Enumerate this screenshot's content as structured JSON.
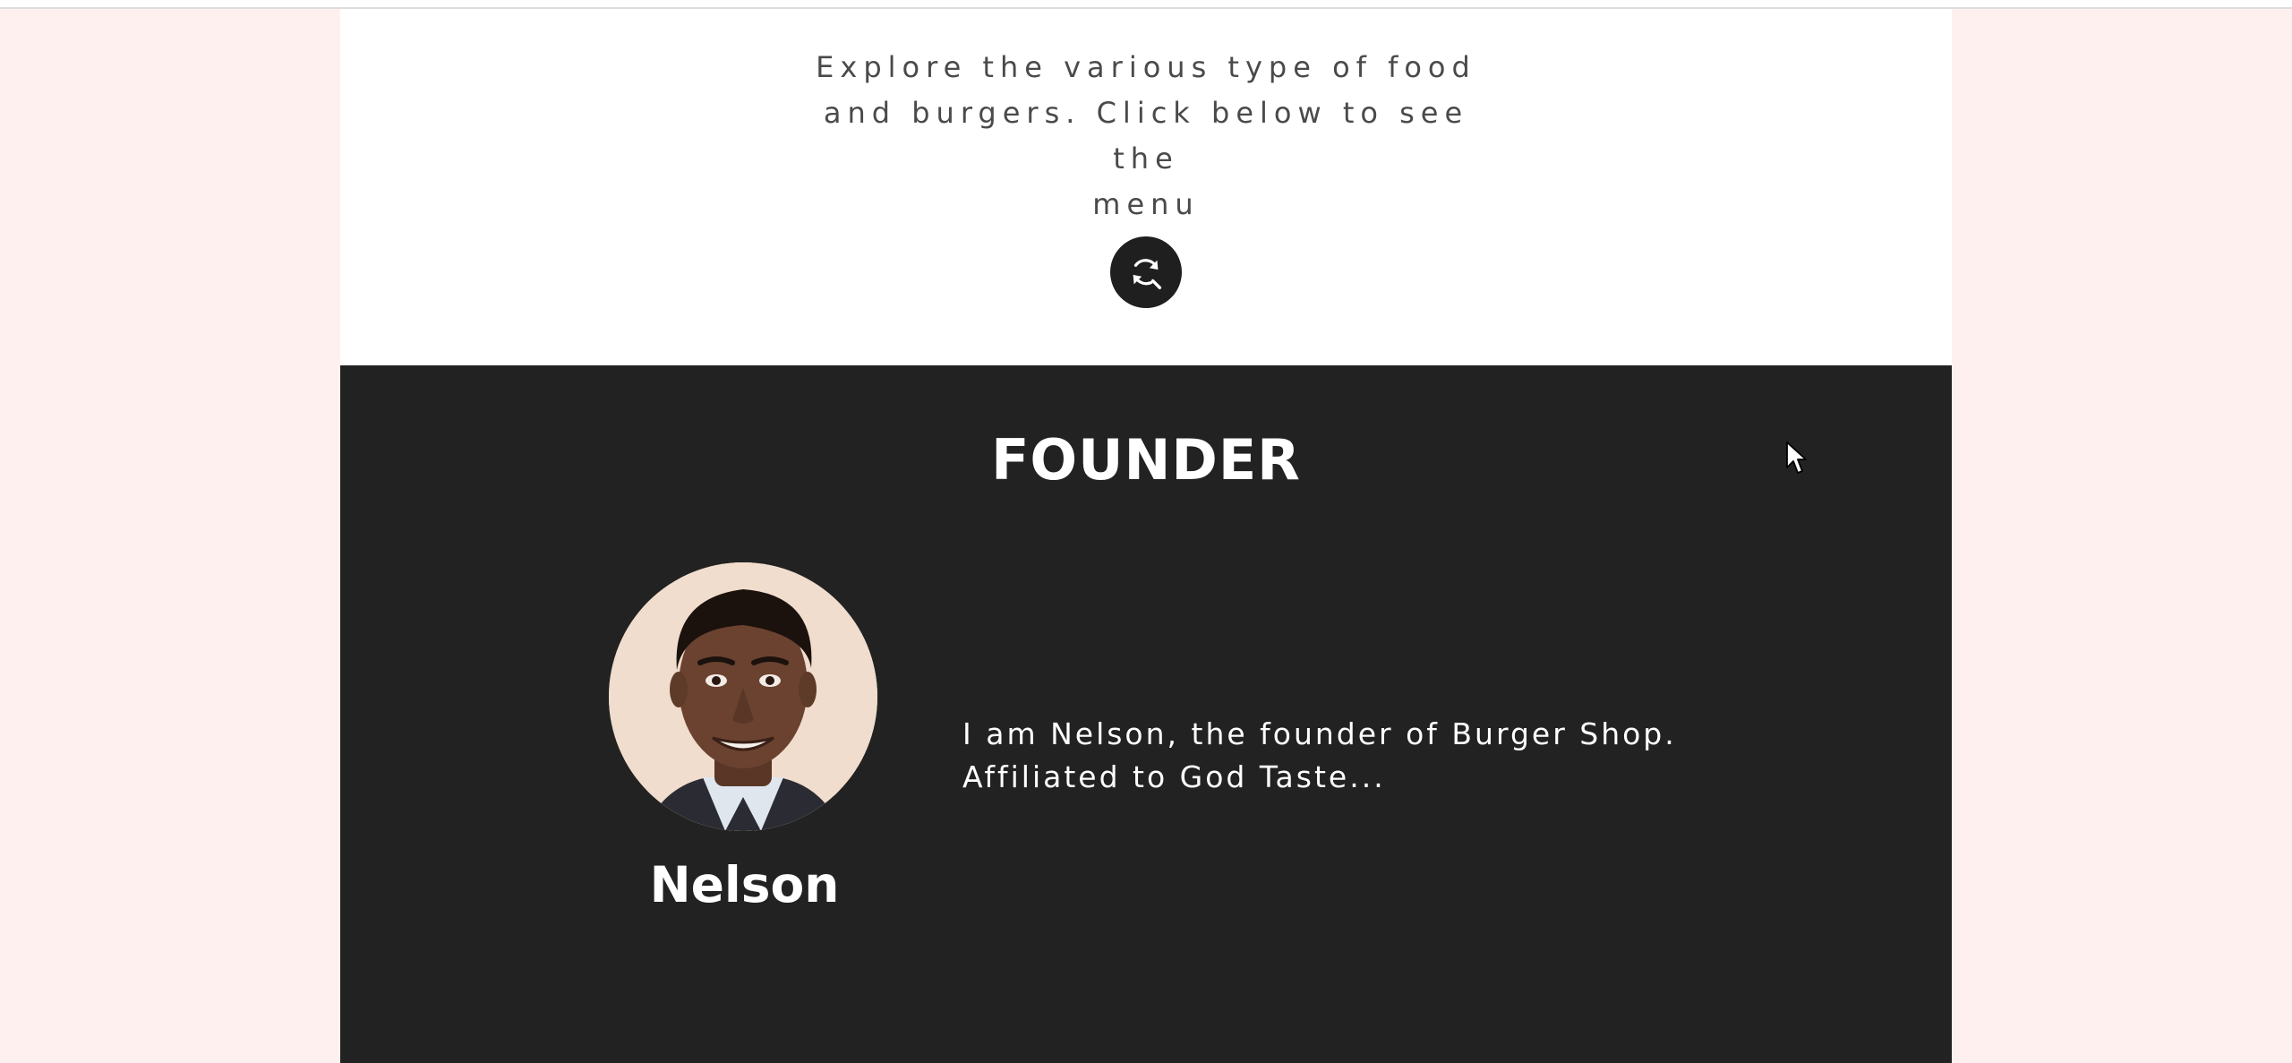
{
  "explore": {
    "line1": "Explore the various type of food",
    "line2": "and burgers. Click below to see the",
    "line3": "menu",
    "menu_button_icon": "refresh-search-icon"
  },
  "founder": {
    "title": "FOUNDER",
    "name": "Nelson",
    "bio_line1": "I am Nelson, the founder of Burger Shop.",
    "bio_line2": "Affiliated to God Taste...",
    "avatar_alt": "founder-portrait"
  },
  "colors": {
    "page_background": "#fff0f0",
    "section_dark": "#222222",
    "text_light": "#ffffff",
    "text_muted": "#4a4a4a",
    "button_dark": "#1f1f1f"
  }
}
